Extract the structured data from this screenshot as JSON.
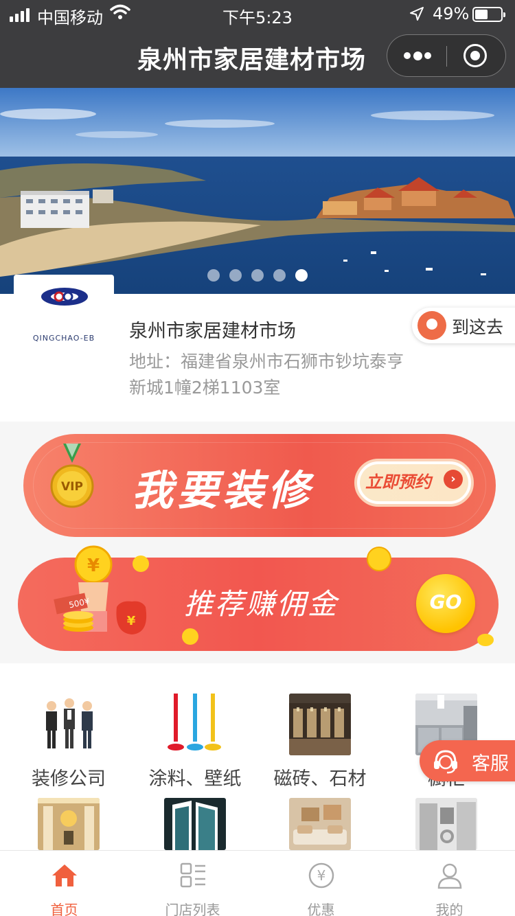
{
  "status_bar": {
    "carrier": "中国移动",
    "time": "下午5:23",
    "battery": "49%"
  },
  "nav": {
    "title": "泉州市家居建材市场"
  },
  "banner": {
    "slide_count": 5,
    "active_slide": 5
  },
  "shop": {
    "logo_text": "QINGCHAO-EB",
    "name": "泉州市家居建材市场",
    "address": "地址：福建省泉州市石狮市钞坑泰亨新城1幢2梯1103室",
    "goto_label": "到这去"
  },
  "promo_decorate": {
    "title": "我要装修",
    "button": "立即预约",
    "badge": "VIP"
  },
  "promo_referral": {
    "title": "推荐赚佣金",
    "button": "GO",
    "tag": "500¥"
  },
  "categories": [
    {
      "label": "装修公司",
      "icon": "business-people-icon"
    },
    {
      "label": "涂料、壁纸",
      "icon": "paint-drip-icon"
    },
    {
      "label": "磁砖、石材",
      "icon": "tile-showroom-icon"
    },
    {
      "label": "橱柜",
      "icon": "kitchen-icon"
    },
    {
      "label": "",
      "icon": "chandelier-room-icon"
    },
    {
      "label": "",
      "icon": "window-door-icon"
    },
    {
      "label": "",
      "icon": "living-room-icon"
    },
    {
      "label": "",
      "icon": "appliance-icon"
    }
  ],
  "customer_service": {
    "label": "客服"
  },
  "tabbar": [
    {
      "label": "首页",
      "icon": "home-icon",
      "active": true
    },
    {
      "label": "门店列表",
      "icon": "store-list-icon",
      "active": false
    },
    {
      "label": "优惠",
      "icon": "yen-coupon-icon",
      "active": false
    },
    {
      "label": "我的",
      "icon": "user-icon",
      "active": false
    }
  ],
  "colors": {
    "accent": "#f0603e",
    "nav_bg": "#3d3d3f",
    "promo_red": "#f05a4d",
    "coin_yellow": "#ffc300"
  }
}
